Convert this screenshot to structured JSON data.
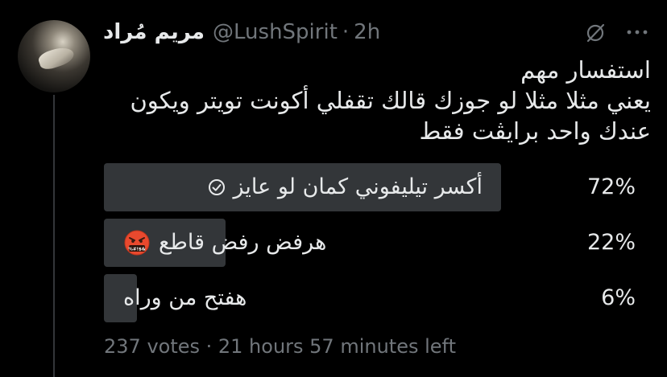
{
  "tweet": {
    "display_name": "مريم مُراد",
    "handle": "@LushSpirit",
    "separator": "·",
    "time": "2h",
    "text_lines": [
      "استفسار مهم",
      "يعني مثلا مثلا لو جوزك قالك تقفلي أكونت تويتر ويكون",
      "عندك واحد برايڤت فقط"
    ]
  },
  "icons": {
    "grok": "grok-icon",
    "more": "more-dots-icon",
    "check": "check-circle-icon",
    "emoji": "face-with-symbols-on-mouth-emoji"
  },
  "poll": {
    "options": [
      {
        "label": "أكسر تيليفوني كمان لو عايز",
        "percent_text": "72%",
        "fraction": 0.72,
        "selected": true
      },
      {
        "label": "هرفض رفض قاطع",
        "percent_text": "22%",
        "fraction": 0.22,
        "selected": false
      },
      {
        "label": "هفتح من وراه",
        "percent_text": "6%",
        "fraction": 0.06,
        "selected": false
      }
    ],
    "footer": "237 votes · 21 hours 57 minutes left"
  },
  "colors": {
    "background": "#000000",
    "text_primary": "#e7e9ea",
    "text_secondary": "#71767b",
    "poll_bar": "#333639"
  }
}
